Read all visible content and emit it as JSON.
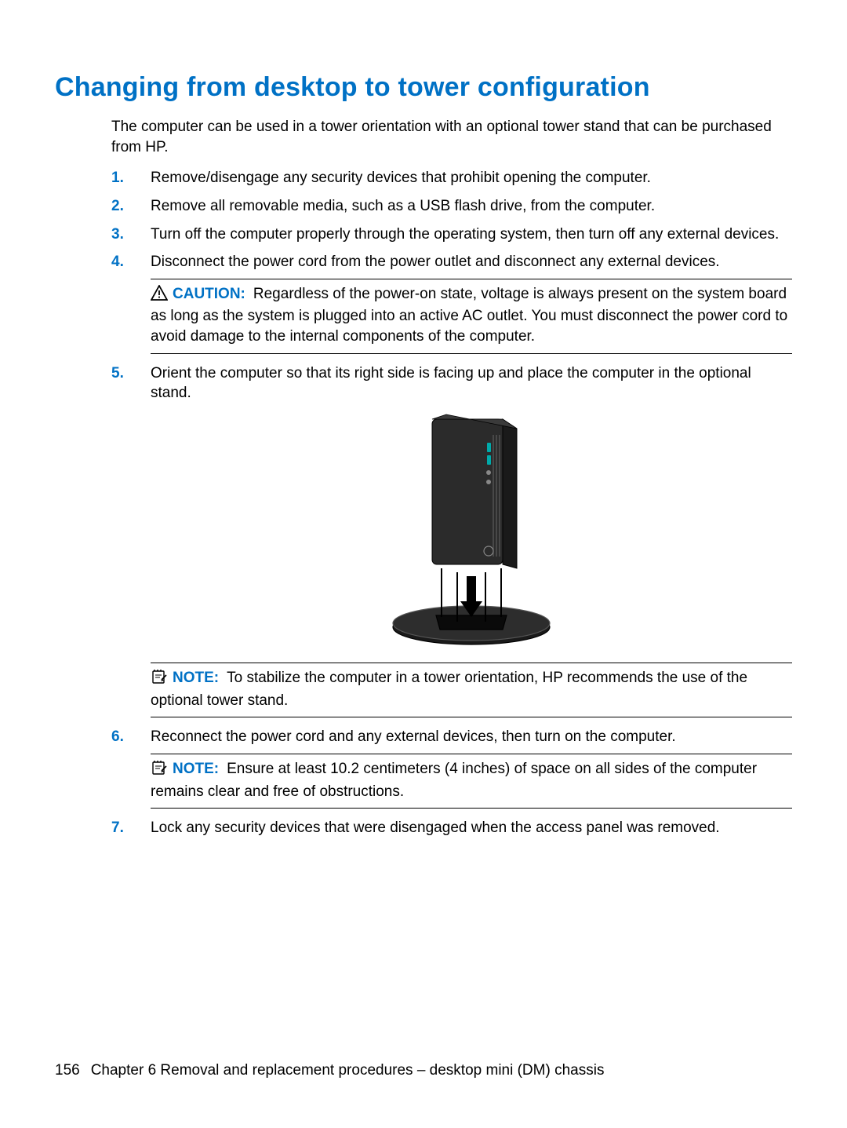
{
  "heading": "Changing from desktop to tower configuration",
  "intro": "The computer can be used in a tower orientation with an optional tower stand that can be purchased from HP.",
  "steps": {
    "s1": "Remove/disengage any security devices that prohibit opening the computer.",
    "s2": "Remove all removable media, such as a USB flash drive, from the computer.",
    "s3": "Turn off the computer properly through the operating system, then turn off any external devices.",
    "s4": "Disconnect the power cord from the power outlet and disconnect any external devices.",
    "s5": "Orient the computer so that its right side is facing up and place the computer in the optional stand.",
    "s6": "Reconnect the power cord and any external devices, then turn on the computer.",
    "s7": "Lock any security devices that were disengaged when the access panel was removed."
  },
  "caution": {
    "label": "CAUTION:",
    "text": "Regardless of the power-on state, voltage is always present on the system board as long as the system is plugged into an active AC outlet. You must disconnect the power cord to avoid damage to the internal components of the computer."
  },
  "note1": {
    "label": "NOTE:",
    "text": "To stabilize the computer in a tower orientation, HP recommends the use of the optional tower stand."
  },
  "note2": {
    "label": "NOTE:",
    "text": "Ensure at least 10.2 centimeters (4 inches) of space on all sides of the computer remains clear and free of obstructions."
  },
  "footer": {
    "page": "156",
    "chapter": "Chapter 6   Removal and replacement procedures – desktop mini (DM) chassis"
  }
}
